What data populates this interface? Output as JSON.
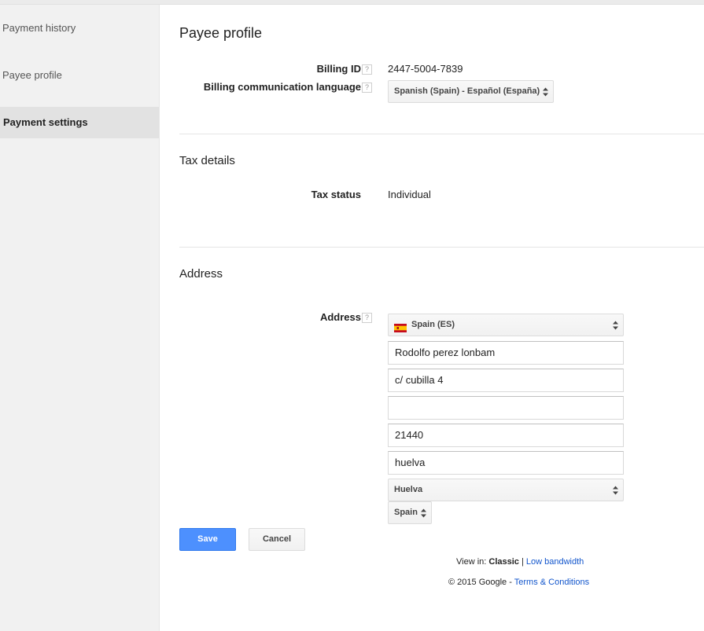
{
  "sidebar": {
    "items": [
      {
        "label": "Payment history"
      },
      {
        "label": "Payee profile"
      },
      {
        "label": "Payment settings"
      }
    ]
  },
  "main": {
    "title": "Payee profile",
    "billing_id_label": "Billing ID",
    "billing_id_value": "2447-5004-7839",
    "language_label": "Billing communication language",
    "language_value": "Spanish (Spain) - Español (España)",
    "help_glyph": "?"
  },
  "tax": {
    "heading": "Tax details",
    "status_label": "Tax status",
    "status_value": "Individual"
  },
  "address": {
    "heading": "Address",
    "label": "Address",
    "country_select": "Spain (ES)",
    "name": "Rodolfo perez lonbam",
    "street": "c/ cubilla 4",
    "street2": "",
    "postal_code": "21440",
    "city": "huelva",
    "province": "Huelva",
    "country_short": "Spain"
  },
  "actions": {
    "save": "Save",
    "cancel": "Cancel"
  },
  "footer": {
    "view_in": "View in:",
    "classic": "Classic",
    "divider": "|",
    "low_bandwidth": "Low bandwidth",
    "copyright": "© 2015 Google -",
    "terms": "Terms & Conditions"
  },
  "colors": {
    "primary_button": "#4d90fe",
    "link": "#1155cc",
    "sidebar_bg": "#f1f1f1",
    "sidebar_active": "#e2e2e2"
  },
  "icons": {
    "flag": "spain-flag-icon",
    "select_arrows": "updown-arrows-icon"
  }
}
